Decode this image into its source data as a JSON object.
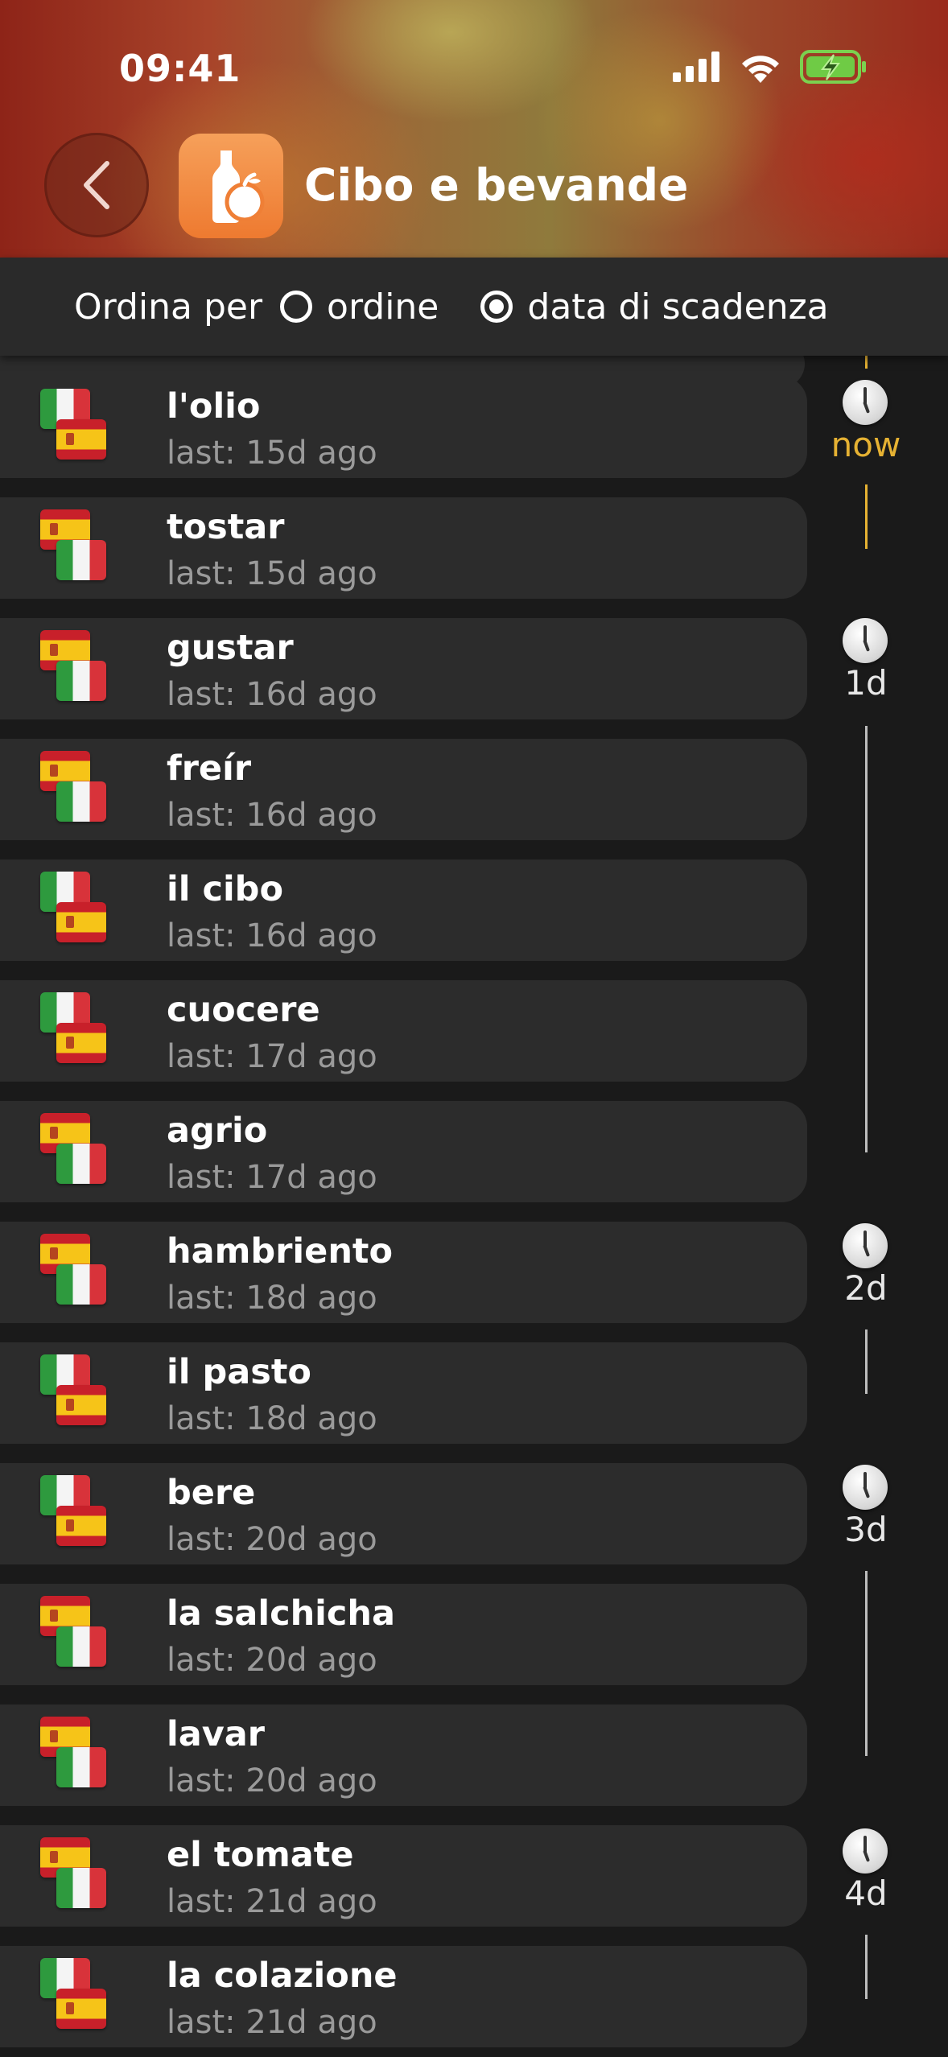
{
  "status_bar": {
    "time": "09:41"
  },
  "header": {
    "title": "Cibo e bevande",
    "icon": "bottle-apple-icon",
    "back_icon": "chevron-left-icon"
  },
  "sort": {
    "label": "Ordina per",
    "options": [
      {
        "label": "ordine",
        "selected": false
      },
      {
        "label": "data di scadenza",
        "selected": true
      }
    ]
  },
  "items": [
    {
      "title": "l'olio",
      "sub": "last: 15d ago",
      "flags": [
        "it",
        "es"
      ]
    },
    {
      "title": "tostar",
      "sub": "last: 15d ago",
      "flags": [
        "es",
        "it"
      ]
    },
    {
      "title": "gustar",
      "sub": "last: 16d ago",
      "flags": [
        "es",
        "it"
      ]
    },
    {
      "title": "freír",
      "sub": "last: 16d ago",
      "flags": [
        "es",
        "it"
      ]
    },
    {
      "title": "il cibo",
      "sub": "last: 16d ago",
      "flags": [
        "it",
        "es"
      ]
    },
    {
      "title": "cuocere",
      "sub": "last: 17d ago",
      "flags": [
        "it",
        "es"
      ]
    },
    {
      "title": "agrio",
      "sub": "last: 17d ago",
      "flags": [
        "es",
        "it"
      ]
    },
    {
      "title": "hambriento",
      "sub": "last: 18d ago",
      "flags": [
        "es",
        "it"
      ]
    },
    {
      "title": "il pasto",
      "sub": "last: 18d ago",
      "flags": [
        "it",
        "es"
      ]
    },
    {
      "title": "bere",
      "sub": "last: 20d ago",
      "flags": [
        "it",
        "es"
      ]
    },
    {
      "title": "la salchicha",
      "sub": "last: 20d ago",
      "flags": [
        "es",
        "it"
      ]
    },
    {
      "title": "lavar",
      "sub": "last: 20d ago",
      "flags": [
        "es",
        "it"
      ]
    },
    {
      "title": "el tomate",
      "sub": "last: 21d ago",
      "flags": [
        "es",
        "it"
      ]
    },
    {
      "title": "la colazione",
      "sub": "last: 21d ago",
      "flags": [
        "it",
        "es"
      ]
    }
  ],
  "timeline": [
    {
      "label": "now",
      "accent": "#e6b233"
    },
    {
      "label": "1d"
    },
    {
      "label": "2d"
    },
    {
      "label": "3d"
    },
    {
      "label": "4d"
    }
  ]
}
